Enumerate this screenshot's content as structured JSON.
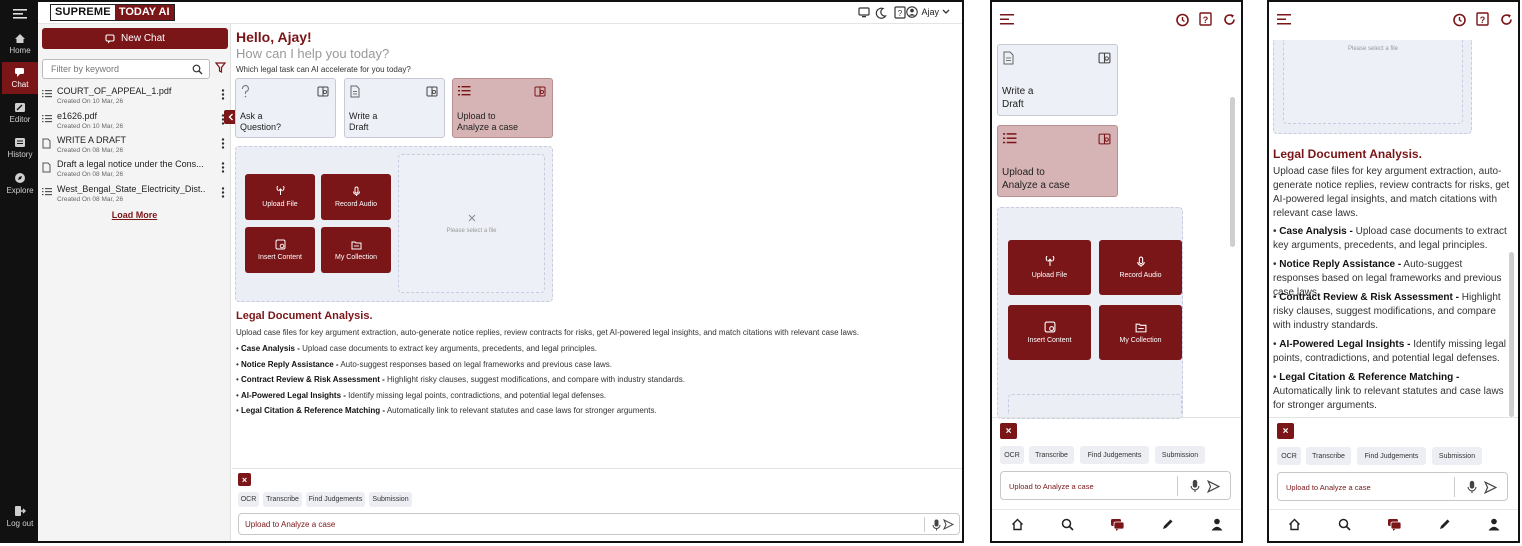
{
  "app": {
    "logo_left": "SUPREME",
    "logo_right": "TODAY AI",
    "user_name": "Ajay"
  },
  "rail": [
    {
      "label": "Home",
      "icon": "home-icon"
    },
    {
      "label": "Chat",
      "icon": "chat-icon"
    },
    {
      "label": "Editor",
      "icon": "editor-icon"
    },
    {
      "label": "History",
      "icon": "history-icon"
    },
    {
      "label": "Explore",
      "icon": "explore-icon"
    }
  ],
  "logout_label": "Log out",
  "sidebar": {
    "new_chat": "New Chat",
    "filter_placeholder": "Filter by keyword",
    "items": [
      {
        "title": "COURT_OF_APPEAL_1.pdf",
        "date": "Created On 10 Mar, 26"
      },
      {
        "title": "e1626.pdf",
        "date": "Created On 10 Mar, 26"
      },
      {
        "title": "WRITE A DRAFT",
        "date": "Created On 08 Mar, 26"
      },
      {
        "title": "Draft a legal notice under the Cons...",
        "date": "Created On 08 Mar, 26"
      },
      {
        "title": "West_Bengal_State_Electricity_Dist...",
        "date": "Created On 08 Mar, 26"
      }
    ],
    "load_more": "Load More"
  },
  "main": {
    "greeting": "Hello, Ajay!",
    "subtitle": "How can I help you today?",
    "prompt": "Which legal task can AI accelerate for you today?",
    "cards": [
      {
        "line1": "Ask a",
        "line2": "Question?"
      },
      {
        "line1": "Write a",
        "line2": "Draft"
      },
      {
        "line1": "Upload to",
        "line2": "Analyze a case"
      }
    ],
    "tiles": [
      {
        "label": "Upload File",
        "icon": "upload-icon"
      },
      {
        "label": "Record Audio",
        "icon": "microphone-icon"
      },
      {
        "label": "Insert Content",
        "icon": "insert-content-icon"
      },
      {
        "label": "My Collection",
        "icon": "folder-icon"
      }
    ],
    "empty_text": "Please select a file",
    "section_title": "Legal Document Analysis.",
    "section_intro": "Upload case files for key argument extraction, auto-generate notice replies, review contracts for risks, get AI-powered legal insights, and match citations with relevant case laws.",
    "bullets": [
      {
        "title": "Case Analysis -",
        "text": " Upload case documents to extract key arguments, precedents, and legal principles."
      },
      {
        "title": "Notice Reply Assistance -",
        "text": " Auto-suggest responses based on legal frameworks and previous case laws."
      },
      {
        "title": "Contract Review & Risk Assessment -",
        "text": " Highlight risky clauses, suggest modifications, and compare with industry standards."
      },
      {
        "title": "AI-Powered Legal Insights -",
        "text": " Identify missing legal points, contradictions, and potential legal defenses."
      },
      {
        "title": "Legal Citation & Reference Matching -",
        "text": " Automatically link to relevant statutes and case laws for stronger arguments."
      }
    ],
    "chips": [
      "OCR",
      "Transcribe",
      "Find Judgements",
      "Submission"
    ],
    "input_text": "Upload to Analyze a case",
    "close_label": "×"
  },
  "mobile1": {
    "cards": [
      {
        "line1": "Write a",
        "line2": "Draft"
      },
      {
        "line1": "Upload to",
        "line2": "Analyze a case"
      }
    ],
    "tiles": [
      "Upload File",
      "Record Audio",
      "Insert Content",
      "My Collection"
    ]
  },
  "mobile2": {
    "empty_text": "Please select a file",
    "section_title": "Legal Document Analysis.",
    "section_intro": "Upload case files for key argument extraction, auto-generate notice replies, review contracts for risks, get AI-powered legal insights, and match citations with relevant case laws.",
    "bullets": [
      {
        "title": "Case Analysis -",
        "text": " Upload case documents to extract key arguments, precedents, and legal principles."
      },
      {
        "title": "Notice Reply Assistance -",
        "text": " Auto-suggest responses based on legal frameworks and previous case laws."
      },
      {
        "title": "Contract Review & Risk Assessment -",
        "text": " Highlight risky clauses, suggest modifications, and compare with industry standards."
      },
      {
        "title": "AI-Powered Legal Insights -",
        "text": " Identify missing legal points, contradictions, and potential legal defenses."
      },
      {
        "title": "Legal Citation & Reference Matching -",
        "text": " Automatically link to relevant statutes and case laws for stronger arguments."
      }
    ]
  },
  "colors": {
    "accent": "#7a1518",
    "selected_card": "#d6b3b4",
    "card_bg": "#eef0f7"
  }
}
